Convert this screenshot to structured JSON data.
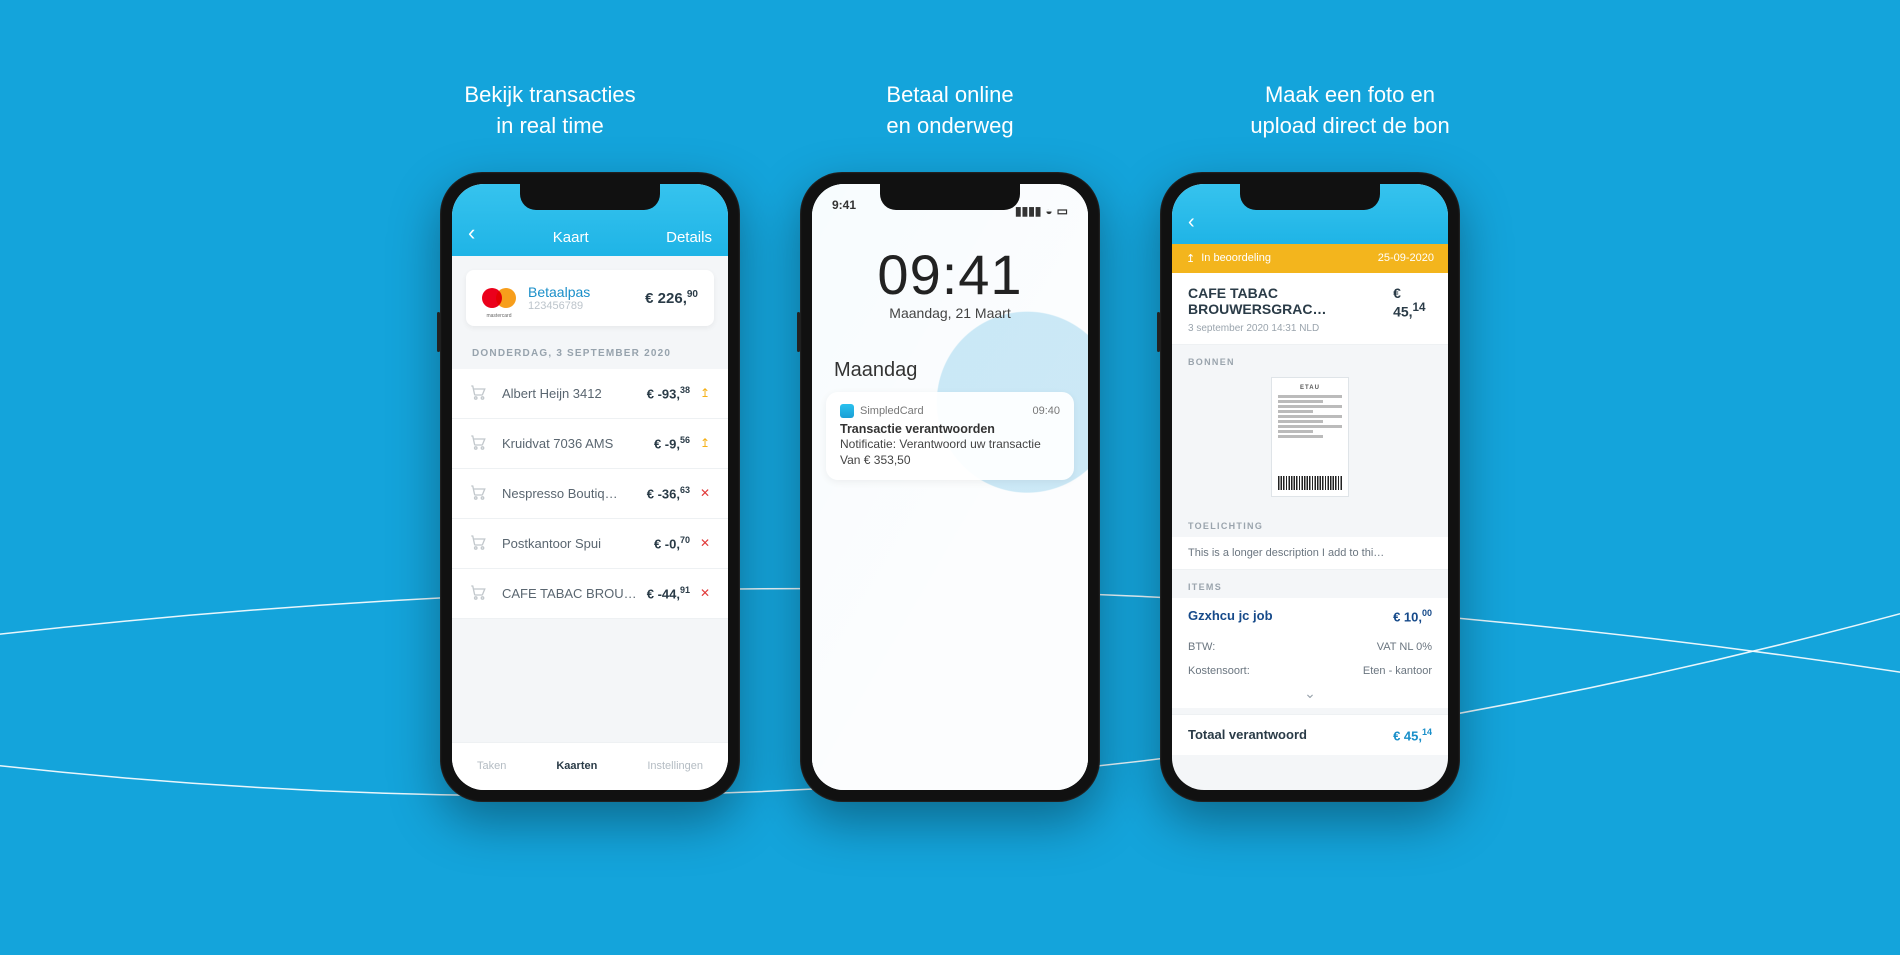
{
  "captions": [
    "Bekijk transacties\nin real time",
    "Betaal online\nen onderweg",
    "Maak een foto en\nupload direct de bon"
  ],
  "phone1": {
    "header": {
      "title": "Kaart",
      "action": "Details"
    },
    "card": {
      "name": "Betaalpas",
      "number": "123456789",
      "balance_int": "€ 226,",
      "balance_frac": "90"
    },
    "date_separator": "DONDERDAG, 3 SEPTEMBER 2020",
    "transactions": [
      {
        "merchant": "Albert Heijn 3412",
        "amount_int": "€ -93,",
        "amount_frac": "38",
        "status": "up"
      },
      {
        "merchant": "Kruidvat 7036 AMS",
        "amount_int": "€ -9,",
        "amount_frac": "56",
        "status": "up"
      },
      {
        "merchant": "Nespresso Boutiq…",
        "amount_int": "€ -36,",
        "amount_frac": "63",
        "status": "x"
      },
      {
        "merchant": "Postkantoor Spui",
        "amount_int": "€ -0,",
        "amount_frac": "70",
        "status": "x"
      },
      {
        "merchant": "CAFE TABAC BROUW…",
        "amount_int": "€ -44,",
        "amount_frac": "91",
        "status": "x"
      }
    ],
    "tabs": [
      "Taken",
      "Kaarten",
      "Instellingen"
    ]
  },
  "phone2": {
    "status_time": "9:41",
    "clock_time": "09:41",
    "clock_date": "Maandag, 21 Maart",
    "day_label": "Maandag",
    "notification": {
      "app": "SimpledCard",
      "time": "09:40",
      "title": "Transactie verantwoorden",
      "line1": "Notificatie: Verantwoord uw transactie",
      "line2": "Van € 353,50"
    }
  },
  "phone3": {
    "gold": {
      "status": "In beoordeling",
      "date": "25-09-2020"
    },
    "head": {
      "title": "CAFE TABAC BROUWERSGRAC…",
      "amount_int": "€ 45,",
      "amount_frac": "14",
      "meta": "3 september 2020 14:31 NLD"
    },
    "sections": {
      "bonnen": "BONNEN",
      "toelichting": "TOELICHTING",
      "items": "ITEMS"
    },
    "receipt_brand": "ETAU",
    "description": "This is a longer description I add to thi…",
    "item": {
      "name": "Gzxhcu jc job",
      "price_int": "€ 10,",
      "price_frac": "00"
    },
    "kv": [
      {
        "k": "BTW:",
        "v": "VAT NL 0%"
      },
      {
        "k": "Kostensoort:",
        "v": "Eten - kantoor"
      }
    ],
    "total": {
      "label": "Totaal verantwoord",
      "val_int": "€ 45,",
      "val_frac": "14"
    }
  }
}
